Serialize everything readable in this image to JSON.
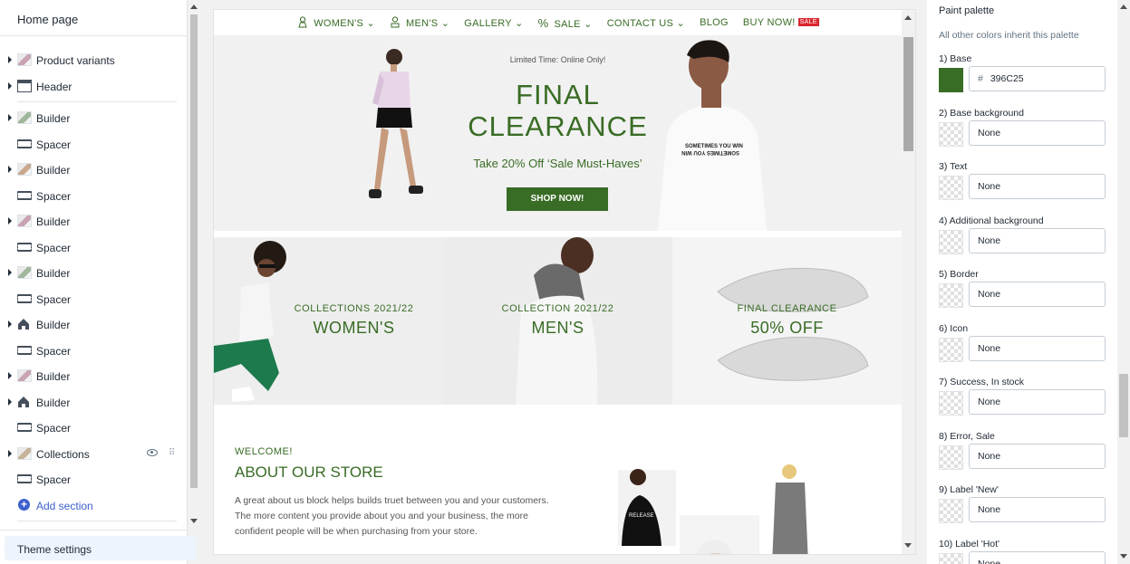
{
  "left": {
    "title": "Home page",
    "items": [
      {
        "label": "Product variants",
        "icon": "product-thumb-icon",
        "caret": true
      },
      {
        "label": "Header",
        "icon": "header-icon",
        "caret": true
      },
      {
        "label": "Builder",
        "icon": "builder-thumb-icon",
        "caret": true
      },
      {
        "label": "Spacer",
        "icon": "spacer-icon",
        "caret": false
      },
      {
        "label": "Builder",
        "icon": "builder-thumb-icon",
        "caret": true
      },
      {
        "label": "Spacer",
        "icon": "spacer-icon",
        "caret": false
      },
      {
        "label": "Builder",
        "icon": "builder-thumb-icon",
        "caret": true
      },
      {
        "label": "Spacer",
        "icon": "spacer-icon",
        "caret": false
      },
      {
        "label": "Builder",
        "icon": "builder-thumb-icon",
        "caret": true
      },
      {
        "label": "Spacer",
        "icon": "spacer-icon",
        "caret": false
      },
      {
        "label": "Builder",
        "icon": "builder-house-icon",
        "caret": true
      },
      {
        "label": "Spacer",
        "icon": "spacer-icon",
        "caret": false
      },
      {
        "label": "Builder",
        "icon": "builder-thumb-icon",
        "caret": true
      },
      {
        "label": "Builder",
        "icon": "builder-house-icon",
        "caret": true
      },
      {
        "label": "Spacer",
        "icon": "spacer-icon",
        "caret": false
      },
      {
        "label": "Collections",
        "icon": "collections-thumb-icon",
        "caret": true
      },
      {
        "label": "Spacer",
        "icon": "spacer-icon",
        "caret": false
      }
    ],
    "add_section": "Add section",
    "theme_settings": "Theme settings"
  },
  "preview": {
    "nav": {
      "women": "WOMEN'S",
      "men": "MEN'S",
      "gallery": "GALLERY",
      "sale": "SALE",
      "contact": "CONTACT US",
      "blog": "BLOG",
      "buy": "BUY NOW!",
      "sale_badge": "SALE"
    },
    "hero": {
      "limited": "Limited Time: Online Only!",
      "title_line1": "FINAL",
      "title_line2": "CLEARANCE",
      "subtitle": "Take 20% Off ‘Sale Must-Haves’",
      "button": "SHOP NOW!",
      "tshirt_text": "SOMETIMES YOU WIN"
    },
    "tiles": [
      {
        "sub": "COLLECTIONS 2021/22",
        "main": "WOMEN'S"
      },
      {
        "sub": "COLLECTION 2021/22",
        "main": "MEN'S"
      },
      {
        "sub": "FINAL CLEARANCE",
        "main": "50% OFF"
      }
    ],
    "about": {
      "welcome": "WELCOME!",
      "title": "ABOUT OUR STORE",
      "text": "A great about us block helps builds truet between you and your customers. The more content you provide about you and your business, the more confident people will be when purchasing from your store.",
      "hoodie_text": "RELEASE"
    }
  },
  "right": {
    "title": "Paint palette",
    "subtitle": "All other colors inherit this palette",
    "fields": [
      {
        "label": "1) Base",
        "value": "396C25",
        "swatch": "#396c25"
      },
      {
        "label": "2) Base background",
        "value": "None"
      },
      {
        "label": "3) Text",
        "value": "None"
      },
      {
        "label": "4) Additional background",
        "value": "None"
      },
      {
        "label": "5) Border",
        "value": "None"
      },
      {
        "label": "6) Icon",
        "value": "None"
      },
      {
        "label": "7) Success, In stock",
        "value": "None"
      },
      {
        "label": "8) Error, Sale",
        "value": "None"
      },
      {
        "label": "9) Label 'New'",
        "value": "None"
      },
      {
        "label": "10) Label 'Hot'",
        "value": "None"
      }
    ]
  },
  "colors": {
    "brand": "#396c25",
    "sale": "#d9272e",
    "link": "#3b5fcc"
  }
}
